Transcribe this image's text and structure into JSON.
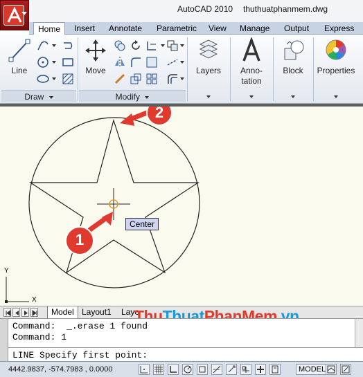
{
  "title_bar": {
    "app_name": "AutoCAD 2010",
    "file_name": "thuthuatphanmem.dwg",
    "app_button_icon": "autocad-logo-icon"
  },
  "ribbon_tabs": [
    "Home",
    "Insert",
    "Annotate",
    "Parametric",
    "View",
    "Manage",
    "Output",
    "Express To"
  ],
  "active_tab": "Home",
  "ribbon": {
    "line_label": "Line",
    "move_label": "Move",
    "layers_label": "Layers",
    "annotation_label_1": "Anno-",
    "annotation_label_2": "tation",
    "block_label": "Block",
    "properties_label": "Properties",
    "draw_panel_title": "Draw",
    "modify_panel_title": "Modify"
  },
  "canvas": {
    "snap_tooltip": "Center",
    "callout_1": "1",
    "callout_2": "2",
    "ucs_x": "X",
    "ucs_y": "Y",
    "callout_color": "#e03a2e",
    "background_color": "#fbfaef"
  },
  "layout_tabs": [
    "Model",
    "Layout1",
    "Layo"
  ],
  "command_window": {
    "history": [
      "Command:  _.erase 1 found",
      "Command: 1"
    ],
    "current_prompt": "LINE Specify first point:"
  },
  "watermark": {
    "part1": "Thu",
    "part2": "Thuat",
    "part3": "PhanMem",
    "part4": ".vn"
  },
  "status_bar": {
    "coordinates": "4442.9837, -574.7983 , 0.0000",
    "model_label": "MODEL"
  }
}
